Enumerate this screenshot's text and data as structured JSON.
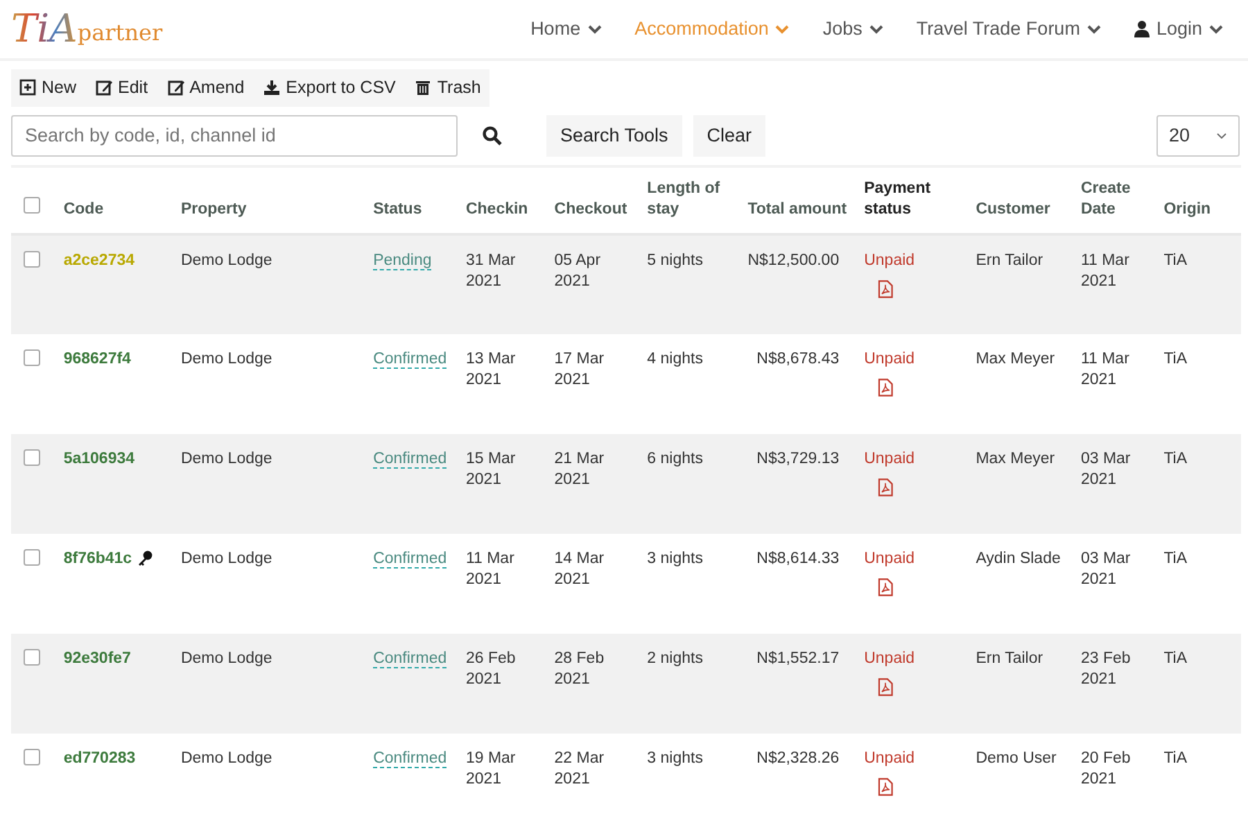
{
  "brand": {
    "mark": "TiA",
    "text": "partner"
  },
  "nav": [
    {
      "label": "Home",
      "selected": false,
      "kind": "menu"
    },
    {
      "label": "Accommodation",
      "selected": true,
      "kind": "menu"
    },
    {
      "label": "Jobs",
      "selected": false,
      "kind": "menu"
    },
    {
      "label": "Travel Trade Forum",
      "selected": false,
      "kind": "menu"
    },
    {
      "label": "Login",
      "selected": false,
      "kind": "user"
    }
  ],
  "toolbar": [
    {
      "label": "New",
      "kind": "new"
    },
    {
      "label": "Edit",
      "kind": "edit"
    },
    {
      "label": "Amend",
      "kind": "edit"
    },
    {
      "label": "Export to CSV",
      "kind": "download"
    },
    {
      "label": "Trash",
      "kind": "trash"
    }
  ],
  "search": {
    "placeholder": "Search by code, id, channel id"
  },
  "buttons": [
    "Search Tools",
    "Clear"
  ],
  "page_size": "20",
  "table": {
    "select_all": {
      "checked": false
    },
    "columns": [
      "Code",
      "Property",
      "Status",
      "Checkin",
      "Checkout",
      "Length of stay",
      "Total amount",
      "Payment status",
      "Customer",
      "Create Date",
      "Origin"
    ],
    "rows": [
      {
        "checked": false,
        "code": "a2ce2734",
        "has_key": false,
        "property": "Demo Lodge",
        "status": "Pending",
        "kind": "pending",
        "checkin": "31 Mar 2021",
        "checkout": "05 Apr 2021",
        "length": "5 nights",
        "total": "N$12,500.00",
        "payment": "Unpaid",
        "customer": "Ern Tailor",
        "created": "11 Mar 2021",
        "origin": "TiA"
      },
      {
        "checked": false,
        "code": "968627f4",
        "has_key": false,
        "property": "Demo Lodge",
        "status": "Confirmed",
        "kind": "confirmed",
        "checkin": "13 Mar 2021",
        "checkout": "17 Mar 2021",
        "length": "4 nights",
        "total": "N$8,678.43",
        "payment": "Unpaid",
        "customer": "Max Meyer",
        "created": "11 Mar 2021",
        "origin": "TiA"
      },
      {
        "checked": false,
        "code": "5a106934",
        "has_key": false,
        "property": "Demo Lodge",
        "status": "Confirmed",
        "kind": "confirmed",
        "checkin": "15 Mar 2021",
        "checkout": "21 Mar 2021",
        "length": "6 nights",
        "total": "N$3,729.13",
        "payment": "Unpaid",
        "customer": "Max Meyer",
        "created": "03 Mar 2021",
        "origin": "TiA"
      },
      {
        "checked": false,
        "code": "8f76b41c",
        "has_key": true,
        "property": "Demo Lodge",
        "status": "Confirmed",
        "kind": "confirmed",
        "checkin": "11 Mar 2021",
        "checkout": "14 Mar 2021",
        "length": "3 nights",
        "total": "N$8,614.33",
        "payment": "Unpaid",
        "customer": "Aydin Slade",
        "created": "03 Mar 2021",
        "origin": "TiA"
      },
      {
        "checked": false,
        "code": "92e30fe7",
        "has_key": false,
        "property": "Demo Lodge",
        "status": "Confirmed",
        "kind": "confirmed",
        "checkin": "26 Feb 2021",
        "checkout": "28 Feb 2021",
        "length": "2 nights",
        "total": "N$1,552.17",
        "payment": "Unpaid",
        "customer": "Ern Tailor",
        "created": "23 Feb 2021",
        "origin": "TiA"
      },
      {
        "checked": false,
        "code": "ed770283",
        "has_key": false,
        "property": "Demo Lodge",
        "status": "Confirmed",
        "kind": "confirmed",
        "checkin": "19 Mar 2021",
        "checkout": "22 Mar 2021",
        "length": "3 nights",
        "total": "N$2,328.26",
        "payment": "Unpaid",
        "customer": "Demo User",
        "created": "20 Feb 2021",
        "origin": "TiA"
      }
    ]
  }
}
